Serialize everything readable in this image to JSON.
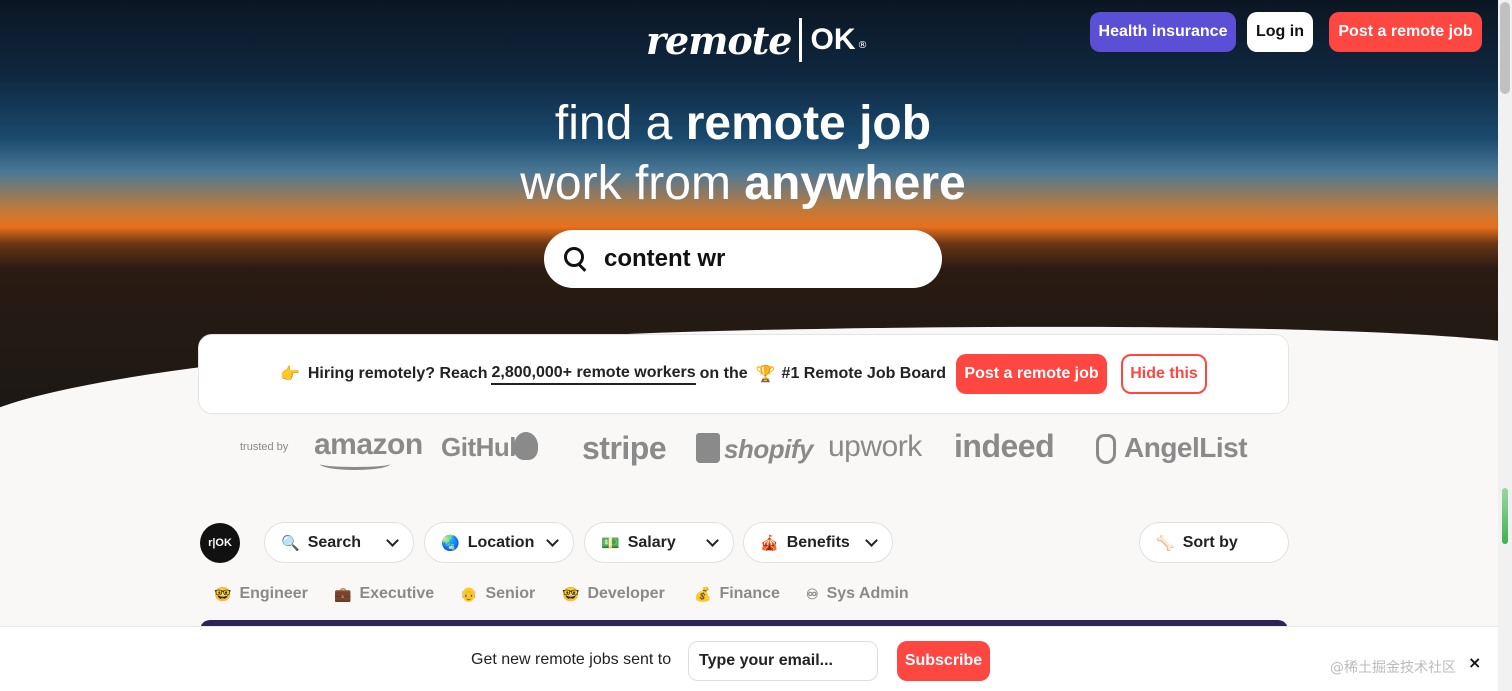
{
  "header": {
    "logo_remote": "remote",
    "logo_ok": "OK",
    "logo_reg": "®",
    "health_label": "Health insurance",
    "login_label": "Log in",
    "post_label": "Post a remote job"
  },
  "hero": {
    "line1_light": "find a ",
    "line1_bold": "remote job",
    "line2_light": "work from ",
    "line2_bold": "anywhere",
    "search_value": "content wr"
  },
  "banner": {
    "emoji": "👉",
    "text_before": "Hiring remotely? Reach",
    "highlight": "2,800,000+ remote workers",
    "text_after": "on the",
    "trophy": "🏆",
    "board_label": "#1 Remote Job Board",
    "post_label": "Post a remote job",
    "hide_label": "Hide this"
  },
  "trusted": {
    "label": "trusted by",
    "brands": [
      "amazon",
      "GitHub",
      "stripe",
      "shopify",
      "upwork",
      "indeed",
      "AngelList"
    ]
  },
  "filters": {
    "badge": "r|OK",
    "items": [
      {
        "icon": "🔍",
        "label": "Search"
      },
      {
        "icon": "🌏",
        "label": "Location"
      },
      {
        "icon": "💵",
        "label": "Salary"
      },
      {
        "icon": "🎪",
        "label": "Benefits"
      }
    ],
    "sort": {
      "icon": "🦴",
      "label": "Sort by"
    }
  },
  "tags": [
    {
      "icon": "🤓",
      "label": "Engineer"
    },
    {
      "icon": "💼",
      "label": "Executive"
    },
    {
      "icon": "👴",
      "label": "Senior"
    },
    {
      "icon": "🤓",
      "label": "Developer"
    },
    {
      "icon": "💰",
      "label": "Finance"
    },
    {
      "icon": "♾",
      "label": "Sys Admin"
    }
  ],
  "subscribe": {
    "text": "Get new remote jobs sent to",
    "email_placeholder": "Type your email...",
    "button_label": "Subscribe",
    "close": "×",
    "watermark": "@稀土掘金技术社区"
  },
  "colors": {
    "accent": "#ff4742",
    "health": "#5b4fd6",
    "strip": "#2c2459"
  }
}
